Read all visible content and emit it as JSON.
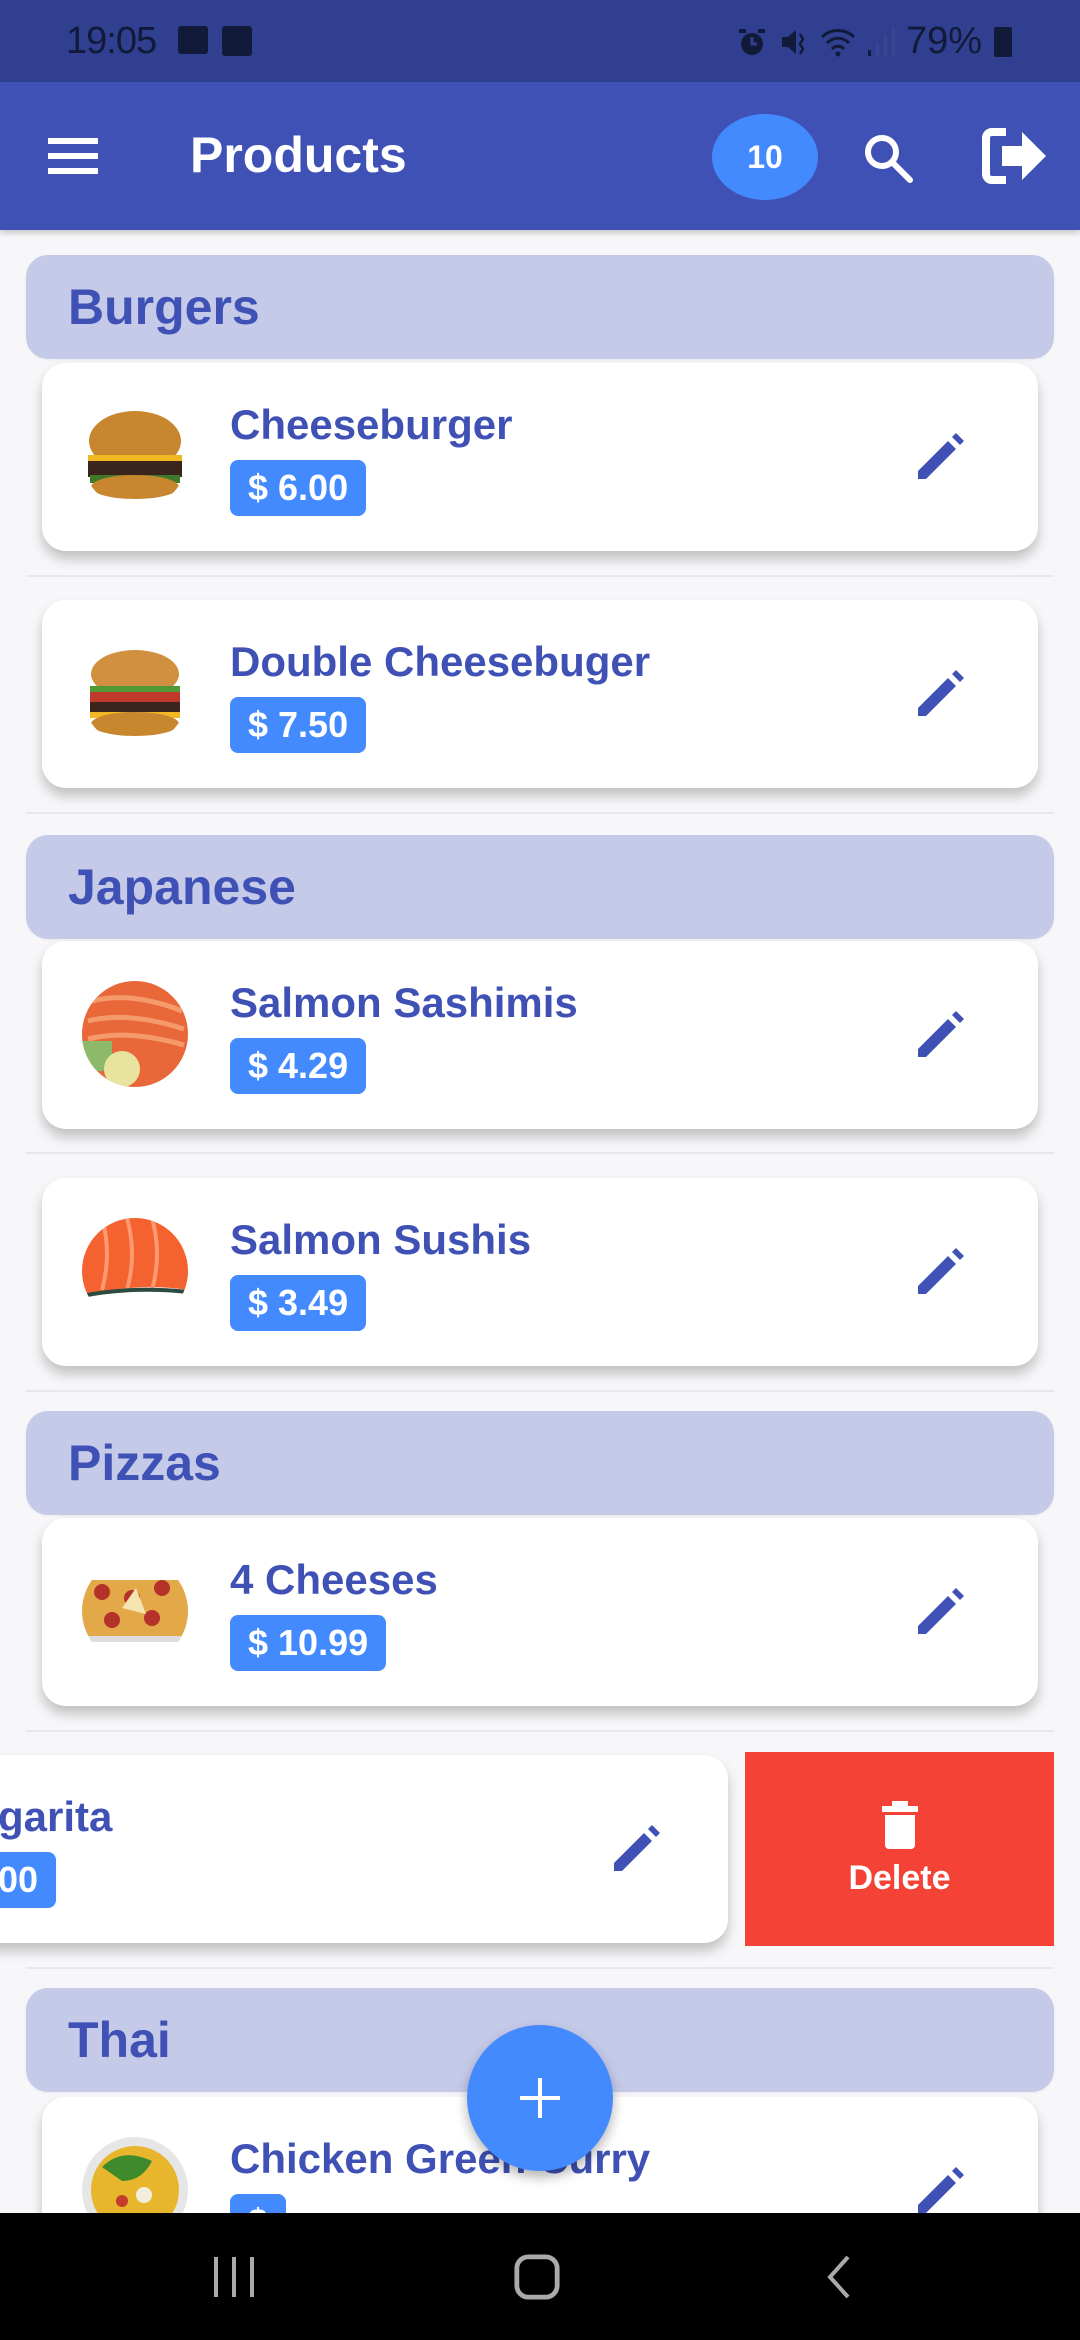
{
  "status_bar": {
    "time": "19:05",
    "battery": "79%",
    "left_icons": [
      "image-icon",
      "voicemail-icon"
    ],
    "right_icons": [
      "alarm-icon",
      "mute-icon",
      "wifi-icon",
      "signal-icon",
      "battery-icon"
    ]
  },
  "app_bar": {
    "title": "Products",
    "count": "10",
    "icons": [
      "menu-icon",
      "search-icon",
      "logout-icon"
    ]
  },
  "colors": {
    "primary": "#3f51b5",
    "status_bar": "#303f8f",
    "accent": "#448aff",
    "category_bg": "#c5cae9",
    "delete": "#f44336"
  },
  "categories": [
    {
      "name": "Burgers",
      "items": [
        {
          "name": "Cheeseburger",
          "price": "$ 6.00",
          "image": "cheeseburger"
        },
        {
          "name": "Double Cheesebuger",
          "price": "$ 7.50",
          "image": "double-cheeseburger"
        }
      ]
    },
    {
      "name": "Japanese",
      "items": [
        {
          "name": "Salmon Sashimis",
          "price": "$ 4.29",
          "image": "salmon-sashimi"
        },
        {
          "name": "Salmon Sushis",
          "price": "$ 3.49",
          "image": "salmon-sushi"
        }
      ]
    },
    {
      "name": "Pizzas",
      "items": [
        {
          "name": "4 Cheeses",
          "price": "$ 10.99",
          "image": "pizza-4-cheeses"
        },
        {
          "name": "garita",
          "price": "00",
          "image": "",
          "swiped": true
        }
      ]
    },
    {
      "name": "Thai",
      "items": [
        {
          "name": "Chicken Green Curry",
          "price": "$",
          "image": "green-curry"
        }
      ]
    }
  ],
  "swipe_action": {
    "label": "Delete",
    "icon": "trash-icon"
  },
  "fab": {
    "icon": "plus-icon",
    "label": "+"
  },
  "nav_bar": {
    "buttons": [
      "recent-apps",
      "home",
      "back"
    ]
  }
}
